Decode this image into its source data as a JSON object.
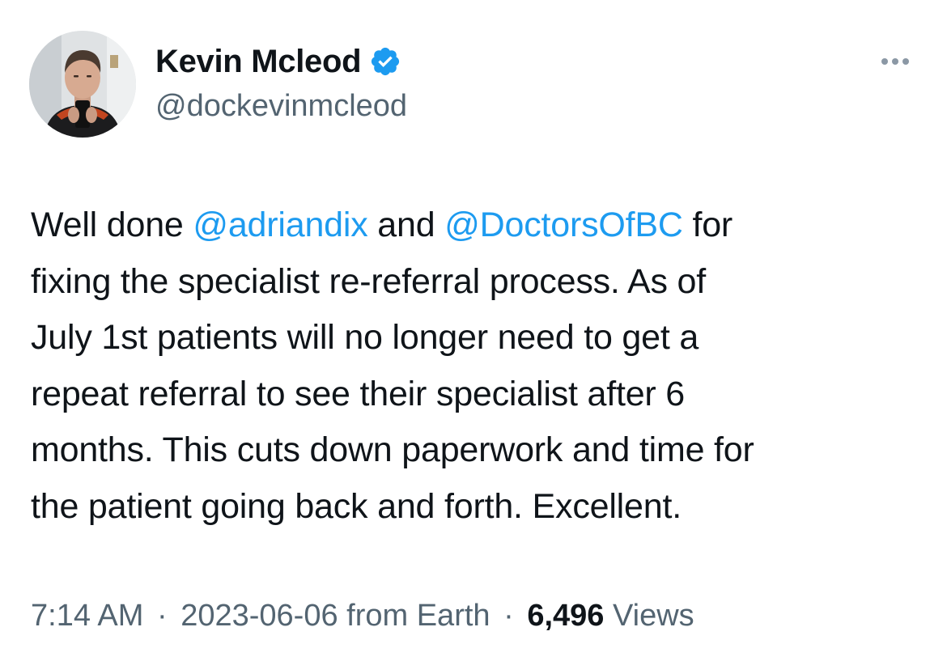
{
  "author": {
    "display_name": "Kevin Mcleod",
    "handle": "@dockevinmcleod",
    "verified_icon": "verified-badge-icon",
    "avatar_icon": "avatar"
  },
  "more_icon": "more-horizontal-icon",
  "tweet": {
    "lines": [
      [
        {
          "text": "Well done ",
          "type": "text"
        },
        {
          "text": "@adriandix",
          "type": "mention"
        },
        {
          "text": " and ",
          "type": "text"
        },
        {
          "text": "@DoctorsOfBC",
          "type": "mention"
        },
        {
          "text": " for",
          "type": "text"
        }
      ],
      [
        {
          "text": "fixing the specialist re-referral process. As of",
          "type": "text"
        }
      ],
      [
        {
          "text": "July 1st patients will no longer need to get a",
          "type": "text"
        }
      ],
      [
        {
          "text": "repeat referral to see their specialist after 6",
          "type": "text"
        }
      ],
      [
        {
          "text": "months. This cuts down paperwork and time for",
          "type": "text"
        }
      ],
      [
        {
          "text": "the patient going back and forth. Excellent.",
          "type": "text"
        }
      ]
    ]
  },
  "meta": {
    "time": "7:14 AM",
    "separator": "·",
    "date": "2023-06-06",
    "source": "from Earth",
    "views_count": "6,496",
    "views_label": "Views"
  },
  "colors": {
    "link": "#1d9bf0",
    "secondary_text": "#536471",
    "primary_text": "#0f1419",
    "verified": "#1d9bf0"
  }
}
